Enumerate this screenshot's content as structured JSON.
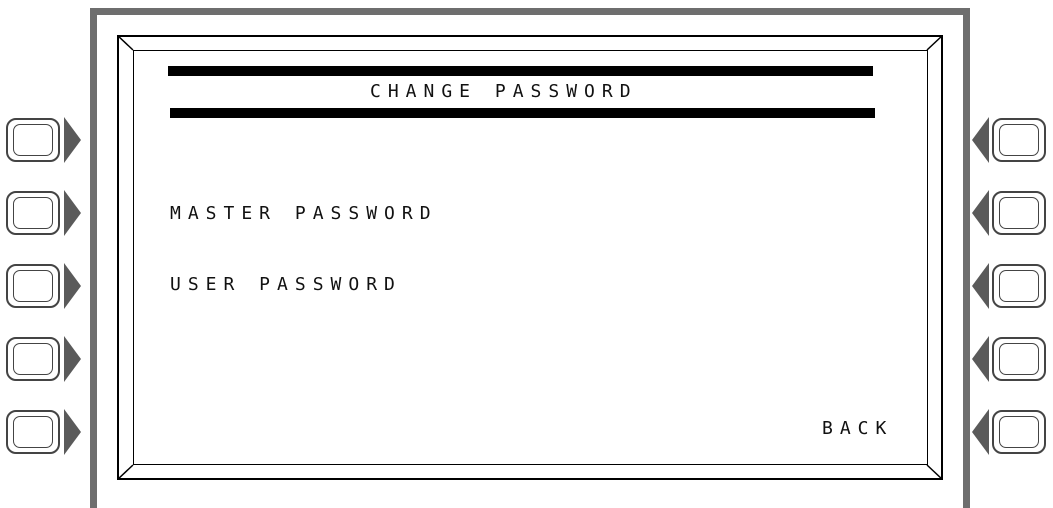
{
  "screen": {
    "title": "CHANGE PASSWORD",
    "options": [
      {
        "label": "MASTER PASSWORD"
      },
      {
        "label": "USER PASSWORD"
      }
    ],
    "back_label": "BACK"
  },
  "soft_keys": {
    "left_count": 5,
    "right_count": 5,
    "left_icon": "arrow-right-icon",
    "right_icon": "arrow-left-icon"
  },
  "colors": {
    "bezel": "#6e6e6e",
    "screen_background": "#ffffff",
    "text": "#111111"
  }
}
